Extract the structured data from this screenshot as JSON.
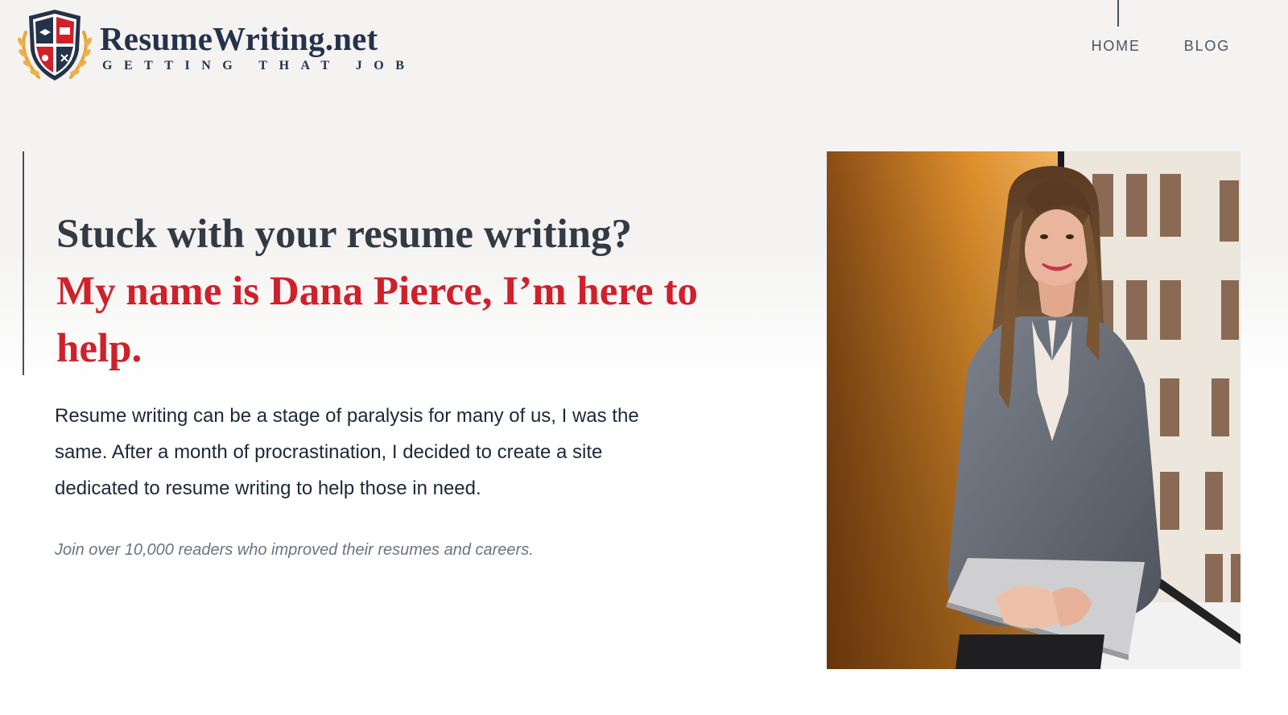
{
  "header": {
    "site_name": "ResumeWriting.net",
    "tagline": "Getting that job",
    "nav": [
      "HOME",
      "BLOG"
    ]
  },
  "hero": {
    "headline_line1": "Stuck with your resume writing?",
    "headline_line2": "My name is Dana Pierce, I’m here to help.",
    "intro": "Resume writing can be a stage of paralysis for many of us, I was the same. After a month of procrastination, I decided to create a site dedicated to resume writing to help those in need.",
    "social_proof": "Join over 10,000 readers who improved their resumes and careers."
  },
  "icons": {
    "logo": "shield-crest-icon",
    "photo": "portrait-photo"
  },
  "colors": {
    "brand_navy": "#24324a",
    "accent_red": "#d0202a",
    "background": "#f4f3f2"
  }
}
